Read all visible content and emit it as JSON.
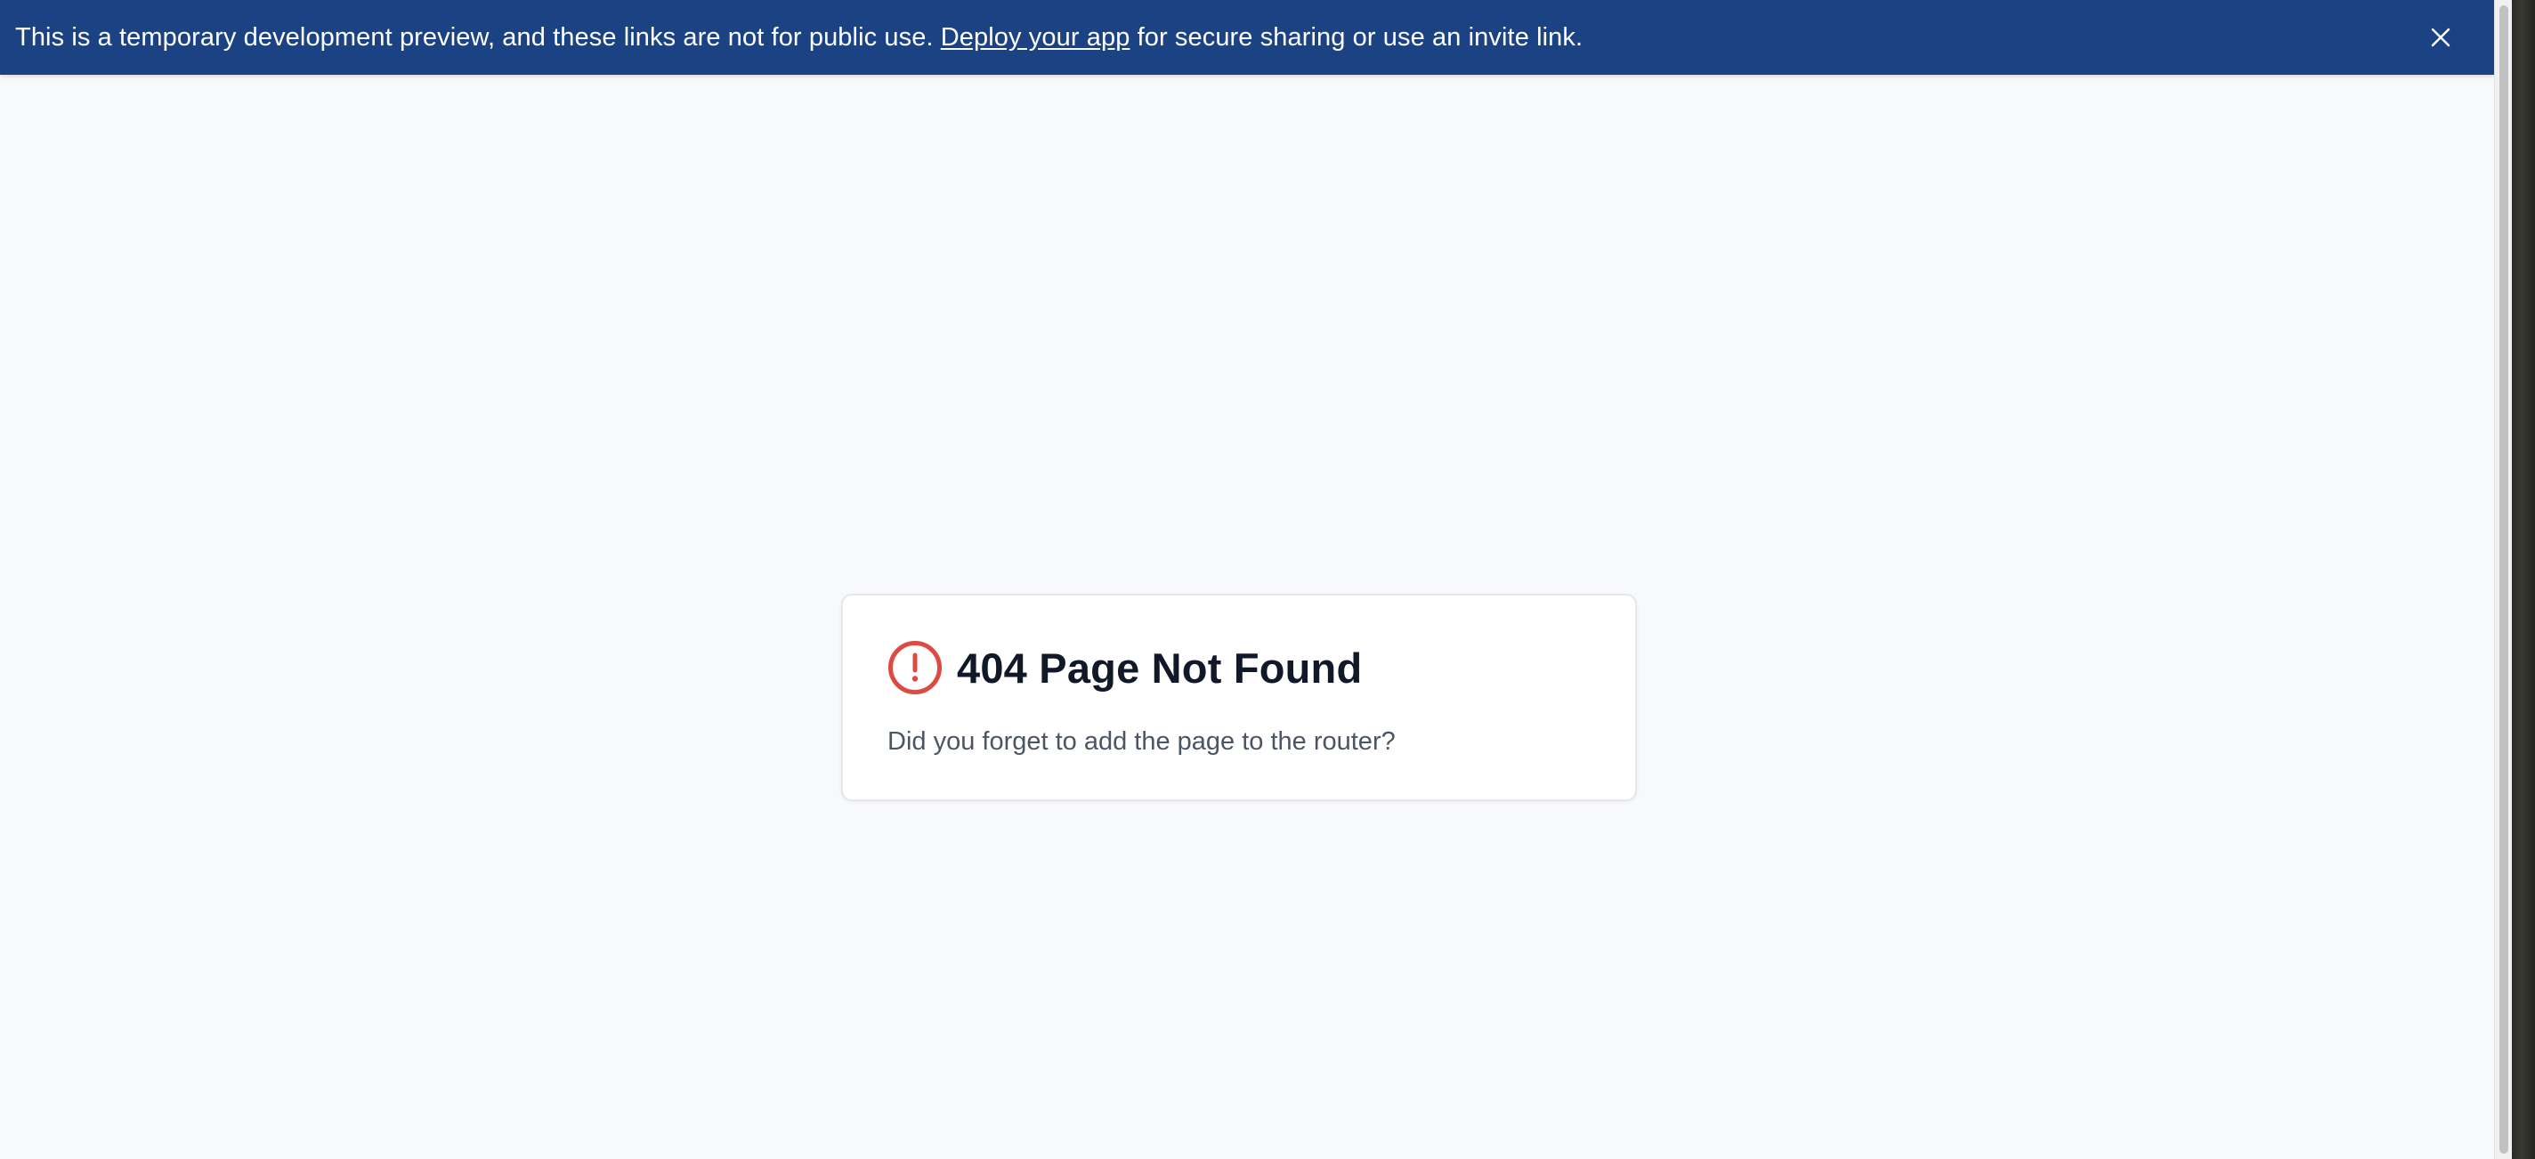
{
  "banner": {
    "text_before": "This is a temporary development preview, and these links are not for public use. ",
    "link_text": "Deploy your app",
    "text_after": " for secure sharing or use an invite link.",
    "close_icon": "close-icon",
    "background_color": "#1b4282"
  },
  "error_card": {
    "icon": "alert-circle-icon",
    "icon_color": "#dc4a41",
    "title": "404 Page Not Found",
    "message": "Did you forget to add the page to the router?"
  }
}
